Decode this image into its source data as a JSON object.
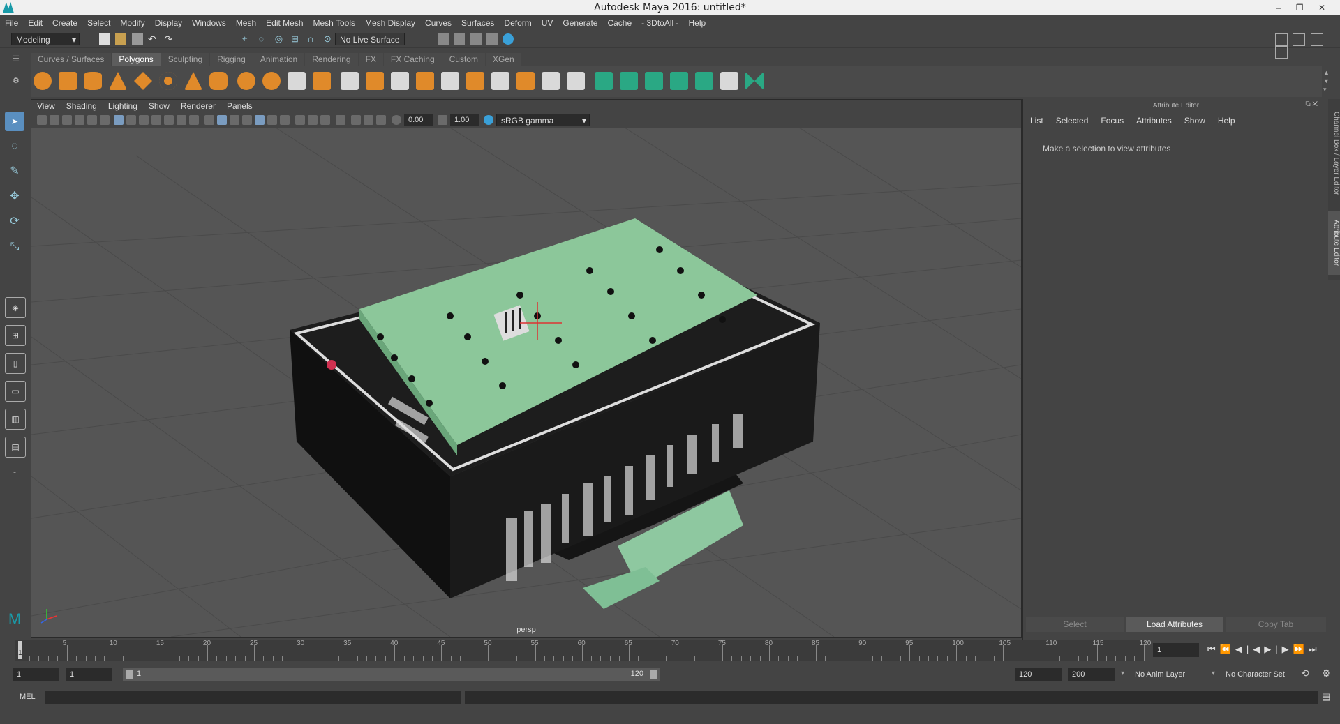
{
  "window": {
    "title": "Autodesk Maya 2016: untitled*",
    "min": "–",
    "max": "❐",
    "close": "✕"
  },
  "menus": [
    "File",
    "Edit",
    "Create",
    "Select",
    "Modify",
    "Display",
    "Windows",
    "Mesh",
    "Edit Mesh",
    "Mesh Tools",
    "Mesh Display",
    "Curves",
    "Surfaces",
    "Deform",
    "UV",
    "Generate",
    "Cache",
    "- 3DtoAll -",
    "Help"
  ],
  "status": {
    "mode": "Modeling",
    "live_surface": "No Live Surface"
  },
  "shelf_tabs": [
    "Curves / Surfaces",
    "Polygons",
    "Sculpting",
    "Rigging",
    "Animation",
    "Rendering",
    "FX",
    "FX Caching",
    "Custom",
    "XGen"
  ],
  "active_shelf_tab": "Polygons",
  "viewport": {
    "menus": [
      "View",
      "Shading",
      "Lighting",
      "Show",
      "Renderer",
      "Panels"
    ],
    "exposure": "0.00",
    "gamma": "1.00",
    "color_space": "sRGB gamma",
    "camera": "persp"
  },
  "attribute_editor": {
    "title": "Attribute Editor",
    "menus": [
      "List",
      "Selected",
      "Focus",
      "Attributes",
      "Show",
      "Help"
    ],
    "message": "Make a selection to view attributes",
    "buttons": [
      "Select",
      "Load Attributes",
      "Copy Tab"
    ]
  },
  "side_tabs": [
    "Channel Box / Layer Editor",
    "Attribute Editor"
  ],
  "time_slider": {
    "ticks": [
      "5",
      "10",
      "15",
      "20",
      "25",
      "30",
      "35",
      "40",
      "45",
      "50",
      "55",
      "60",
      "65",
      "70",
      "75",
      "80",
      "85",
      "90",
      "95",
      "100",
      "105",
      "110",
      "115",
      "120"
    ],
    "current": "1",
    "current_frame_field": "1"
  },
  "range": {
    "start": "1",
    "inner_start": "1",
    "slider_start": "1",
    "slider_end": "120",
    "end": "120",
    "outer_end": "200",
    "anim_layer": "No Anim Layer",
    "char_set": "No Character Set"
  },
  "cmd": {
    "label": "MEL"
  }
}
